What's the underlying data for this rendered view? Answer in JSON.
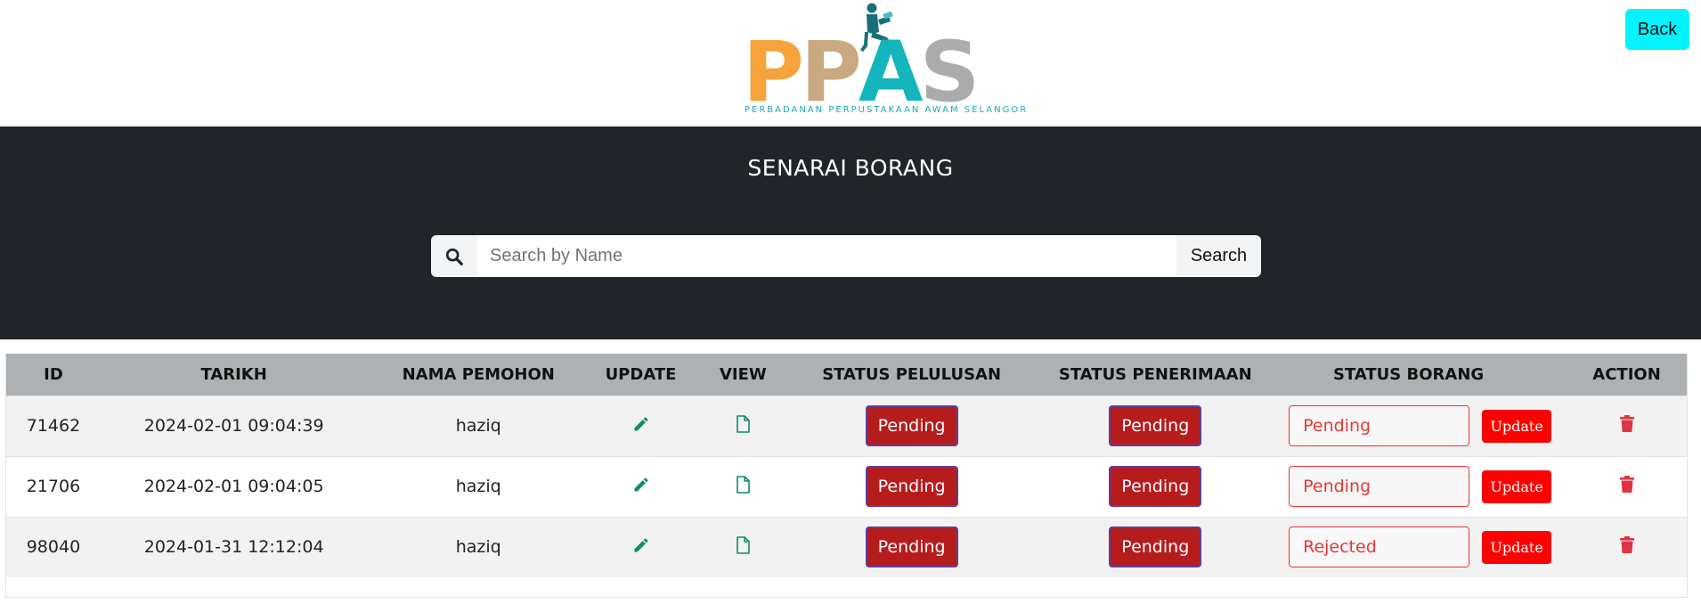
{
  "header": {
    "logo_text": "PPAS",
    "logo_subtitle": "PERBADANAN PERPUSTAKAAN AWAM SELANGOR",
    "back_label": "Back",
    "colors": {
      "p1": "#f5a33a",
      "p2": "#c8a980",
      "a": "#15b5be",
      "s": "#a9abad",
      "back": "#00f5ff"
    }
  },
  "banner": {
    "title": "SENARAI BORANG",
    "search": {
      "placeholder": "Search by Name",
      "value": "",
      "button_label": "Search",
      "icon": "search-icon"
    }
  },
  "table": {
    "columns": [
      "ID",
      "TARIKH",
      "NAMA PEMOHON",
      "UPDATE",
      "VIEW",
      "STATUS PELULUSAN",
      "STATUS PENERIMAAN",
      "STATUS BORANG",
      "ACTION"
    ],
    "rows": [
      {
        "id": "71462",
        "tarikh": "2024-02-01 09:04:39",
        "nama": "haziq",
        "status_pelulusan": "Pending",
        "status_penerimaan": "Pending",
        "status_borang": "Pending",
        "update_label": "Update"
      },
      {
        "id": "21706",
        "tarikh": "2024-02-01 09:04:05",
        "nama": "haziq",
        "status_pelulusan": "Pending",
        "status_penerimaan": "Pending",
        "status_borang": "Pending",
        "update_label": "Update"
      },
      {
        "id": "98040",
        "tarikh": "2024-01-31 12:12:04",
        "nama": "haziq",
        "status_pelulusan": "Pending",
        "status_penerimaan": "Pending",
        "status_borang": "Rejected",
        "update_label": "Update"
      }
    ],
    "icons": {
      "update": "pencil-icon",
      "view": "document-icon",
      "action": "trash-icon"
    },
    "colors": {
      "pending_bg": "#b71c1c",
      "update_btn": "#ff0000",
      "edit_icon": "#0e8a6c",
      "trash_icon": "#dc3545",
      "header_bg": "#aeb1b3"
    }
  }
}
